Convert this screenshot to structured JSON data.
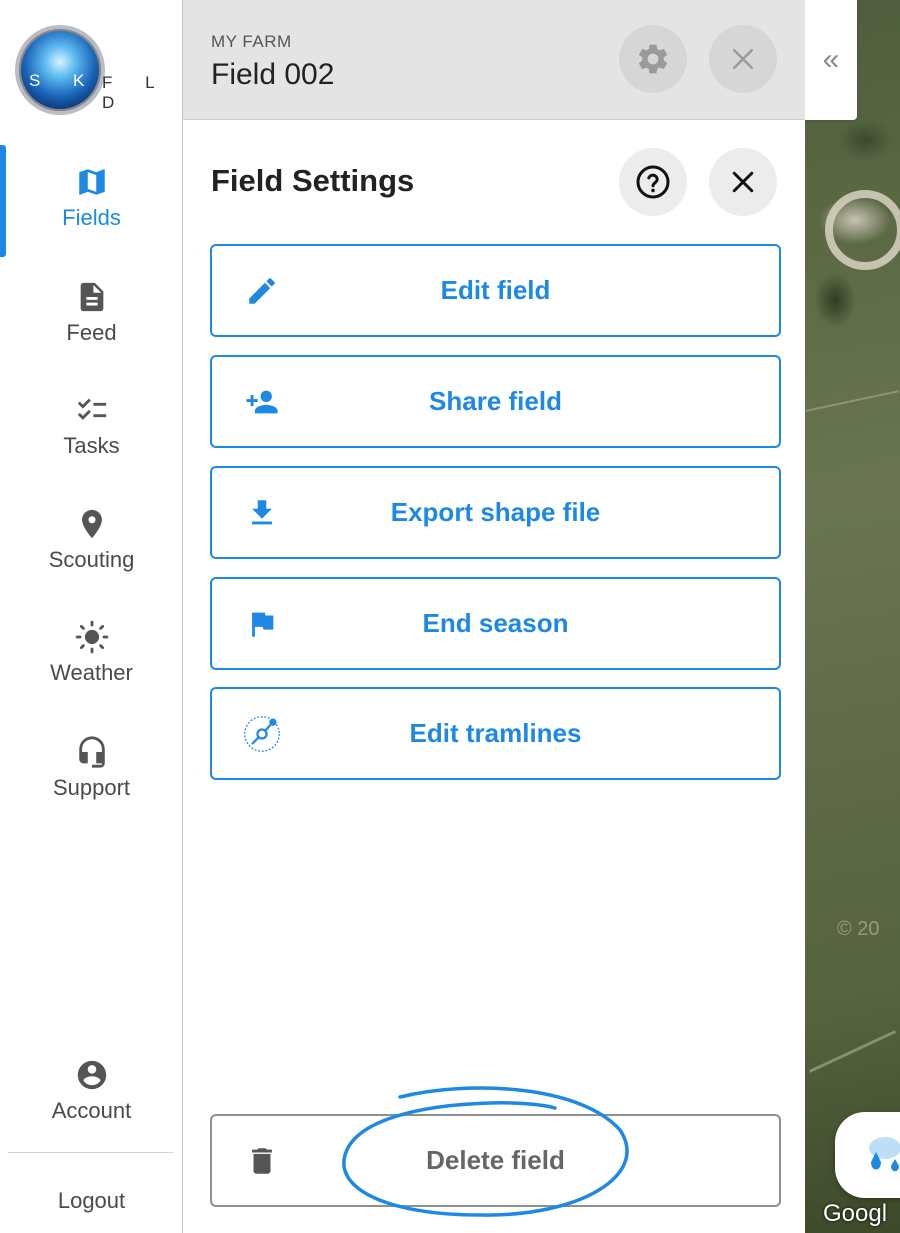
{
  "app": {
    "logo_text": "SKYFLD",
    "logo_left": "S K Y",
    "logo_right": "F L D"
  },
  "sidebar": {
    "items": [
      {
        "label": "Fields",
        "icon": "map-icon",
        "active": true
      },
      {
        "label": "Feed",
        "icon": "document-icon"
      },
      {
        "label": "Tasks",
        "icon": "checklist-icon"
      },
      {
        "label": "Scouting",
        "icon": "location-pin-icon"
      },
      {
        "label": "Weather",
        "icon": "sun-icon"
      },
      {
        "label": "Support",
        "icon": "headset-icon"
      }
    ],
    "account_label": "Account",
    "logout_label": "Logout"
  },
  "header": {
    "farm": "MY FARM",
    "field_name": "Field 002",
    "collapse_glyph": "«"
  },
  "panel": {
    "title": "Field Settings",
    "actions": [
      {
        "label": "Edit field",
        "icon": "pencil-icon"
      },
      {
        "label": "Share field",
        "icon": "add-person-icon"
      },
      {
        "label": "Export shape file",
        "icon": "download-icon"
      },
      {
        "label": "End season",
        "icon": "flag-icon"
      },
      {
        "label": "Edit tramlines",
        "icon": "tramline-icon"
      }
    ],
    "delete_label": "Delete field"
  },
  "map": {
    "attribution": "Googl",
    "watermark": "© 20"
  },
  "colors": {
    "accent": "#1e88e5",
    "header_bg": "#e4e4e4",
    "text_dark": "#222222",
    "delete_gray": "#666666"
  }
}
